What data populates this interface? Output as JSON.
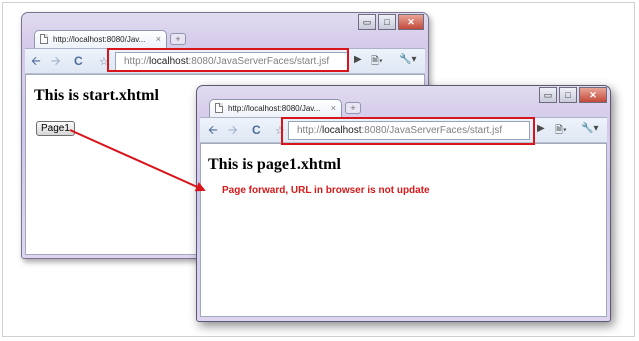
{
  "browser_start": {
    "tab_title": "http://localhost:8080/Jav...",
    "tab_close": "×",
    "new_tab": "+",
    "window_controls": {
      "minimize": "▭",
      "maximize": "□",
      "close": "✕"
    },
    "url": {
      "host_prefix": "http://",
      "host": "localhost",
      "rest": ":8080/JavaServerFaces/start.jsf"
    },
    "page_heading": "This is start.xhtml",
    "page1_button": "Page1"
  },
  "browser_page1": {
    "tab_title": "http://localhost:8080/Jav...",
    "tab_close": "×",
    "new_tab": "+",
    "window_controls": {
      "minimize": "▭",
      "maximize": "□",
      "close": "✕"
    },
    "url": {
      "host_prefix": "http://",
      "host": "localhost",
      "rest": ":8080/JavaServerFaces/start.jsf"
    },
    "page_heading": "This is page1.xhtml"
  },
  "annotation": {
    "note": "Page forward, URL in browser is not update",
    "highlight_color": "#d9141a"
  },
  "icons": {
    "back": "arrow-left-icon",
    "forward": "arrow-right-icon",
    "reload": "reload-icon",
    "bookmark": "star-icon",
    "go": "play-icon",
    "page_menu": "page-menu-icon",
    "tools_menu": "wrench-icon"
  }
}
